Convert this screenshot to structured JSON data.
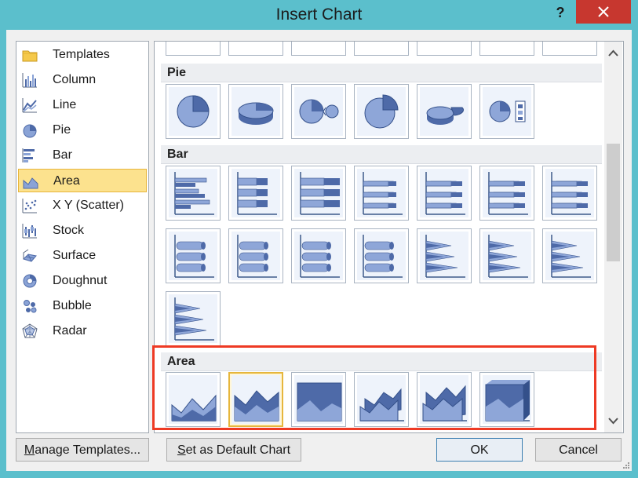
{
  "window": {
    "title": "Insert Chart",
    "help_label": "?"
  },
  "sidebar": {
    "items": [
      {
        "label": "Templates",
        "icon": "folder-icon"
      },
      {
        "label": "Column",
        "icon": "column-chart-icon"
      },
      {
        "label": "Line",
        "icon": "line-chart-icon"
      },
      {
        "label": "Pie",
        "icon": "pie-chart-icon"
      },
      {
        "label": "Bar",
        "icon": "bar-chart-icon"
      },
      {
        "label": "Area",
        "icon": "area-chart-icon",
        "selected": true
      },
      {
        "label": "X Y (Scatter)",
        "icon": "scatter-chart-icon"
      },
      {
        "label": "Stock",
        "icon": "stock-chart-icon"
      },
      {
        "label": "Surface",
        "icon": "surface-chart-icon"
      },
      {
        "label": "Doughnut",
        "icon": "doughnut-chart-icon"
      },
      {
        "label": "Bubble",
        "icon": "bubble-chart-icon"
      },
      {
        "label": "Radar",
        "icon": "radar-chart-icon"
      }
    ]
  },
  "gallery": {
    "sections": [
      {
        "title": "Pie",
        "tile_count": 6
      },
      {
        "title": "Bar",
        "tile_count": 15
      },
      {
        "title": "Area",
        "tile_count": 6,
        "selected_index": 1
      }
    ]
  },
  "buttons": {
    "manage_templates": {
      "prefix": "",
      "mnemonic": "M",
      "rest": "anage Templates..."
    },
    "set_default": {
      "prefix": "",
      "mnemonic": "S",
      "rest": "et as Default Chart"
    },
    "ok": "OK",
    "cancel": "Cancel"
  },
  "colors": {
    "title_bar": "#5bbfcc",
    "close_button": "#c7372f",
    "selection_fill": "#fce28e",
    "highlight_box": "#ee3a24"
  }
}
